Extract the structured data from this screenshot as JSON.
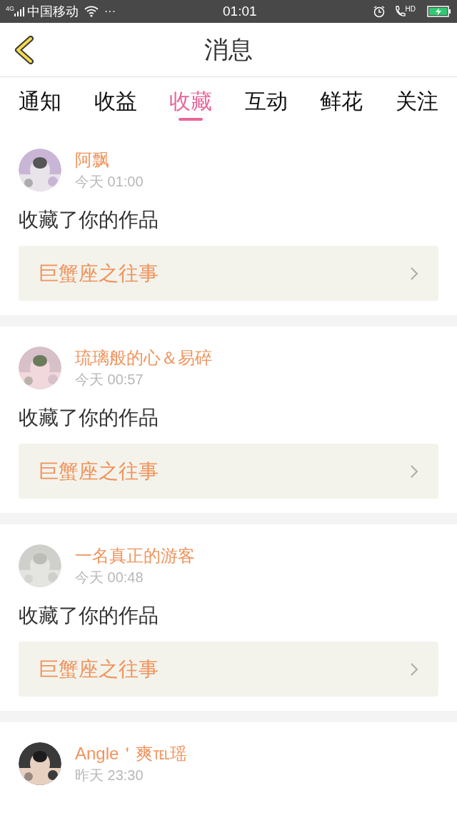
{
  "status_bar": {
    "network": "4G",
    "carrier": "中国移动",
    "more": "···",
    "time": "01:01",
    "hd": "HD"
  },
  "header": {
    "title": "消息"
  },
  "tabs": [
    {
      "label": "通知",
      "selected": false
    },
    {
      "label": "收益",
      "selected": false
    },
    {
      "label": "收藏",
      "selected": true
    },
    {
      "label": "互动",
      "selected": false
    },
    {
      "label": "鲜花",
      "selected": false
    },
    {
      "label": "关注",
      "selected": false
    }
  ],
  "messages": [
    {
      "user": "阿飘",
      "time": "今天 01:00",
      "text": "收藏了你的作品",
      "work": "巨蟹座之往事"
    },
    {
      "user": "琉璃般的心＆易碎",
      "time": "今天 00:57",
      "text": "收藏了你的作品",
      "work": "巨蟹座之往事"
    },
    {
      "user": "一名真正的游客",
      "time": "今天 00:48",
      "text": "收藏了你的作品",
      "work": "巨蟹座之往事"
    },
    {
      "user": "Angle＇爽℡瑶",
      "time": "昨天 23:30"
    }
  ]
}
